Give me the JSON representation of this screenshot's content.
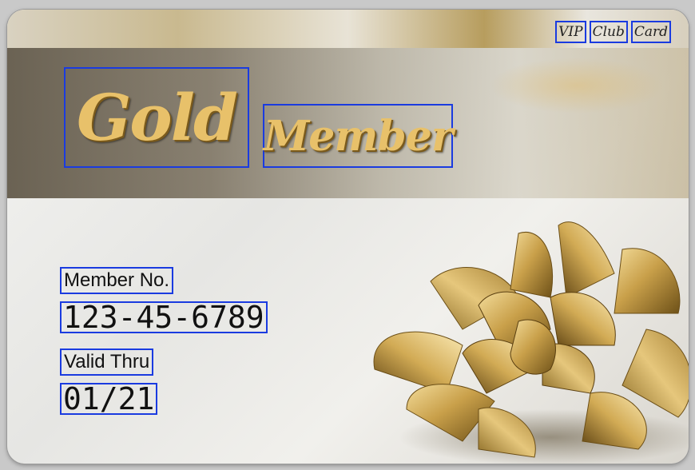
{
  "card": {
    "top_tags": [
      "VIP",
      "Club",
      "Card"
    ],
    "title_word_1": "Gold",
    "title_word_2": "Member",
    "member_no_label": "Member No.",
    "member_no_value": "123-45-6789",
    "valid_thru_label": "Valid Thru",
    "valid_thru_value": "01/21"
  },
  "colors": {
    "title_gold": "#e8c16a",
    "annotation_box": "#1a3be0"
  }
}
